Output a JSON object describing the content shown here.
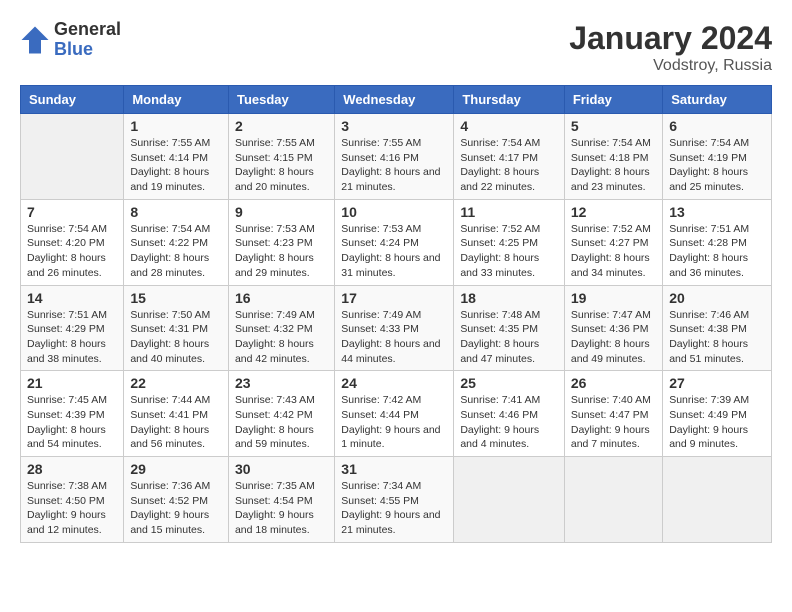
{
  "header": {
    "logo_line1": "General",
    "logo_line2": "Blue",
    "title": "January 2024",
    "subtitle": "Vodstroy, Russia"
  },
  "days_of_week": [
    "Sunday",
    "Monday",
    "Tuesday",
    "Wednesday",
    "Thursday",
    "Friday",
    "Saturday"
  ],
  "weeks": [
    [
      {
        "day": "",
        "sunrise": "",
        "sunset": "",
        "daylight": "",
        "empty": true
      },
      {
        "day": "1",
        "sunrise": "7:55 AM",
        "sunset": "4:14 PM",
        "daylight": "8 hours and 19 minutes."
      },
      {
        "day": "2",
        "sunrise": "7:55 AM",
        "sunset": "4:15 PM",
        "daylight": "8 hours and 20 minutes."
      },
      {
        "day": "3",
        "sunrise": "7:55 AM",
        "sunset": "4:16 PM",
        "daylight": "8 hours and 21 minutes."
      },
      {
        "day": "4",
        "sunrise": "7:54 AM",
        "sunset": "4:17 PM",
        "daylight": "8 hours and 22 minutes."
      },
      {
        "day": "5",
        "sunrise": "7:54 AM",
        "sunset": "4:18 PM",
        "daylight": "8 hours and 23 minutes."
      },
      {
        "day": "6",
        "sunrise": "7:54 AM",
        "sunset": "4:19 PM",
        "daylight": "8 hours and 25 minutes."
      }
    ],
    [
      {
        "day": "7",
        "sunrise": "7:54 AM",
        "sunset": "4:20 PM",
        "daylight": "8 hours and 26 minutes."
      },
      {
        "day": "8",
        "sunrise": "7:54 AM",
        "sunset": "4:22 PM",
        "daylight": "8 hours and 28 minutes."
      },
      {
        "day": "9",
        "sunrise": "7:53 AM",
        "sunset": "4:23 PM",
        "daylight": "8 hours and 29 minutes."
      },
      {
        "day": "10",
        "sunrise": "7:53 AM",
        "sunset": "4:24 PM",
        "daylight": "8 hours and 31 minutes."
      },
      {
        "day": "11",
        "sunrise": "7:52 AM",
        "sunset": "4:25 PM",
        "daylight": "8 hours and 33 minutes."
      },
      {
        "day": "12",
        "sunrise": "7:52 AM",
        "sunset": "4:27 PM",
        "daylight": "8 hours and 34 minutes."
      },
      {
        "day": "13",
        "sunrise": "7:51 AM",
        "sunset": "4:28 PM",
        "daylight": "8 hours and 36 minutes."
      }
    ],
    [
      {
        "day": "14",
        "sunrise": "7:51 AM",
        "sunset": "4:29 PM",
        "daylight": "8 hours and 38 minutes."
      },
      {
        "day": "15",
        "sunrise": "7:50 AM",
        "sunset": "4:31 PM",
        "daylight": "8 hours and 40 minutes."
      },
      {
        "day": "16",
        "sunrise": "7:49 AM",
        "sunset": "4:32 PM",
        "daylight": "8 hours and 42 minutes."
      },
      {
        "day": "17",
        "sunrise": "7:49 AM",
        "sunset": "4:33 PM",
        "daylight": "8 hours and 44 minutes."
      },
      {
        "day": "18",
        "sunrise": "7:48 AM",
        "sunset": "4:35 PM",
        "daylight": "8 hours and 47 minutes."
      },
      {
        "day": "19",
        "sunrise": "7:47 AM",
        "sunset": "4:36 PM",
        "daylight": "8 hours and 49 minutes."
      },
      {
        "day": "20",
        "sunrise": "7:46 AM",
        "sunset": "4:38 PM",
        "daylight": "8 hours and 51 minutes."
      }
    ],
    [
      {
        "day": "21",
        "sunrise": "7:45 AM",
        "sunset": "4:39 PM",
        "daylight": "8 hours and 54 minutes."
      },
      {
        "day": "22",
        "sunrise": "7:44 AM",
        "sunset": "4:41 PM",
        "daylight": "8 hours and 56 minutes."
      },
      {
        "day": "23",
        "sunrise": "7:43 AM",
        "sunset": "4:42 PM",
        "daylight": "8 hours and 59 minutes."
      },
      {
        "day": "24",
        "sunrise": "7:42 AM",
        "sunset": "4:44 PM",
        "daylight": "9 hours and 1 minute."
      },
      {
        "day": "25",
        "sunrise": "7:41 AM",
        "sunset": "4:46 PM",
        "daylight": "9 hours and 4 minutes."
      },
      {
        "day": "26",
        "sunrise": "7:40 AM",
        "sunset": "4:47 PM",
        "daylight": "9 hours and 7 minutes."
      },
      {
        "day": "27",
        "sunrise": "7:39 AM",
        "sunset": "4:49 PM",
        "daylight": "9 hours and 9 minutes."
      }
    ],
    [
      {
        "day": "28",
        "sunrise": "7:38 AM",
        "sunset": "4:50 PM",
        "daylight": "9 hours and 12 minutes."
      },
      {
        "day": "29",
        "sunrise": "7:36 AM",
        "sunset": "4:52 PM",
        "daylight": "9 hours and 15 minutes."
      },
      {
        "day": "30",
        "sunrise": "7:35 AM",
        "sunset": "4:54 PM",
        "daylight": "9 hours and 18 minutes."
      },
      {
        "day": "31",
        "sunrise": "7:34 AM",
        "sunset": "4:55 PM",
        "daylight": "9 hours and 21 minutes."
      },
      {
        "day": "",
        "sunrise": "",
        "sunset": "",
        "daylight": "",
        "empty": true
      },
      {
        "day": "",
        "sunrise": "",
        "sunset": "",
        "daylight": "",
        "empty": true
      },
      {
        "day": "",
        "sunrise": "",
        "sunset": "",
        "daylight": "",
        "empty": true
      }
    ]
  ]
}
